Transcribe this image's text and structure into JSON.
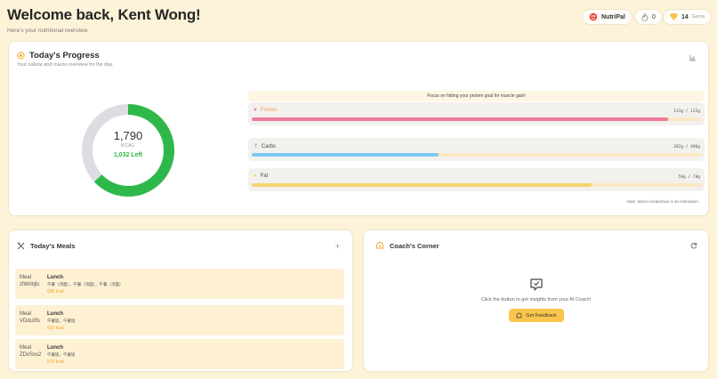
{
  "header": {
    "title": "Welcome back, Kent Wong!",
    "subtitle": "Here's your nutritional overview."
  },
  "topbar": {
    "app_name": "NutriPal",
    "streak": "0",
    "gems_count": "14",
    "gems_label": "Gems"
  },
  "progress": {
    "title": "Today's Progress",
    "subtitle": "Your calorie and macro overview for the day.",
    "calories": "1,790",
    "unit": "KCAL",
    "left": "1,032 Left",
    "consumed_fraction": 0.63,
    "tip": "Focus on hitting your protein goal for muscle gain!",
    "macros": [
      {
        "name": "Protein",
        "value": "113g / 122g",
        "fraction": 0.926,
        "color": "#ee7a99",
        "label_color": "#f5a06b"
      },
      {
        "name": "Carbs",
        "value": "202g / 486g",
        "fraction": 0.416,
        "color": "#7cc9ef",
        "label_color": "#444444"
      },
      {
        "name": "Fat",
        "value": "59g / 78g",
        "fraction": 0.756,
        "color": "#f7d26b",
        "label_color": "#444444"
      }
    ],
    "note": "Note: Macro breakdown is an estimation.",
    "colors": {
      "ring": "#2eb84a",
      "ring_track": "#dcdde2"
    }
  },
  "meals": {
    "title": "Today's Meals",
    "items": [
      {
        "img_alt": "Meal zlWnbjtc",
        "title": "Lunch",
        "desc": "午餐（汤面），午餐（汤面），午餐（汤面）",
        "kcal": "600 kcal"
      },
      {
        "img_alt": "Meal VDdu3fs",
        "title": "Lunch",
        "desc": "午餐饭，午餐饭",
        "kcal": "520 kcal"
      },
      {
        "img_alt": "Meal ZDvSxx2",
        "title": "Lunch",
        "desc": "午餐饭，午餐饭",
        "kcal": "570 kcal"
      }
    ]
  },
  "coach": {
    "title": "Coach's Corner",
    "prompt": "Click the button to get insights from your AI Coach!",
    "button": "Get Feedback"
  }
}
